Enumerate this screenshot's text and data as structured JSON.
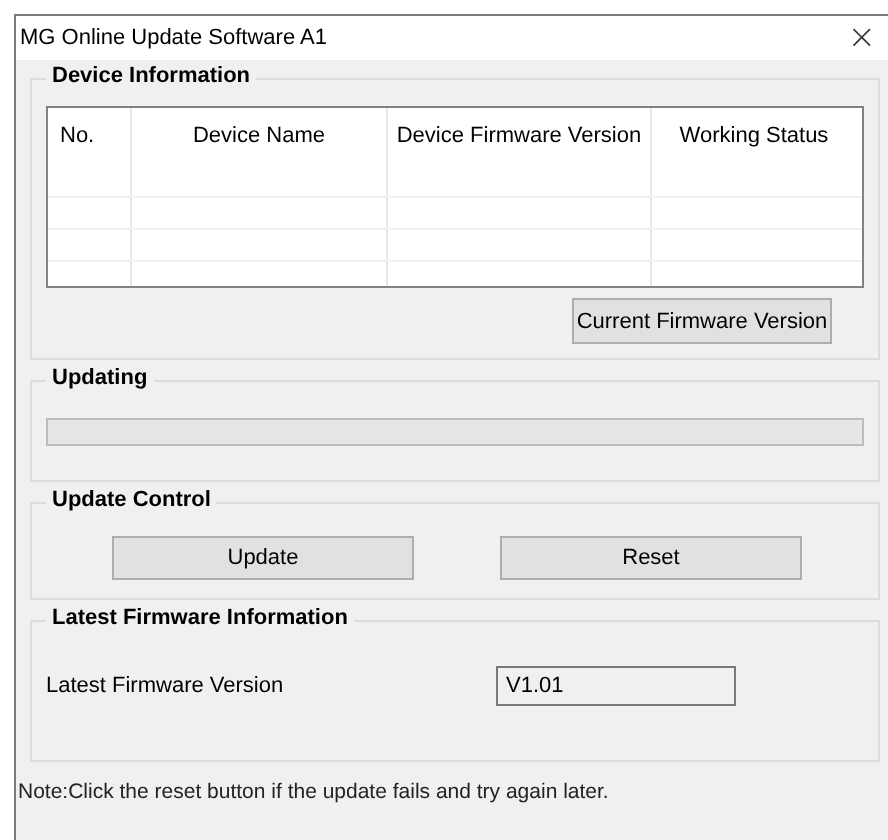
{
  "window": {
    "title": "MG Online Update Software A1",
    "close": "×"
  },
  "device_information": {
    "title": "Device Information",
    "table": {
      "columns": [
        "No.",
        "Device Name",
        "Device Firmware Version",
        "Working Status"
      ]
    },
    "button": "Current Firmware Version"
  },
  "updating": {
    "title": "Updating",
    "progress": {
      "level": 0
    }
  },
  "update_control": {
    "title": "Update Control",
    "buttons": [
      "Update",
      "Reset"
    ]
  },
  "latest_firmware": {
    "title": "Latest Firmware Information",
    "label": "Latest Firmware Version",
    "value": "V1.01"
  },
  "note": "Note:Click the reset button if the update fails and try again later."
}
